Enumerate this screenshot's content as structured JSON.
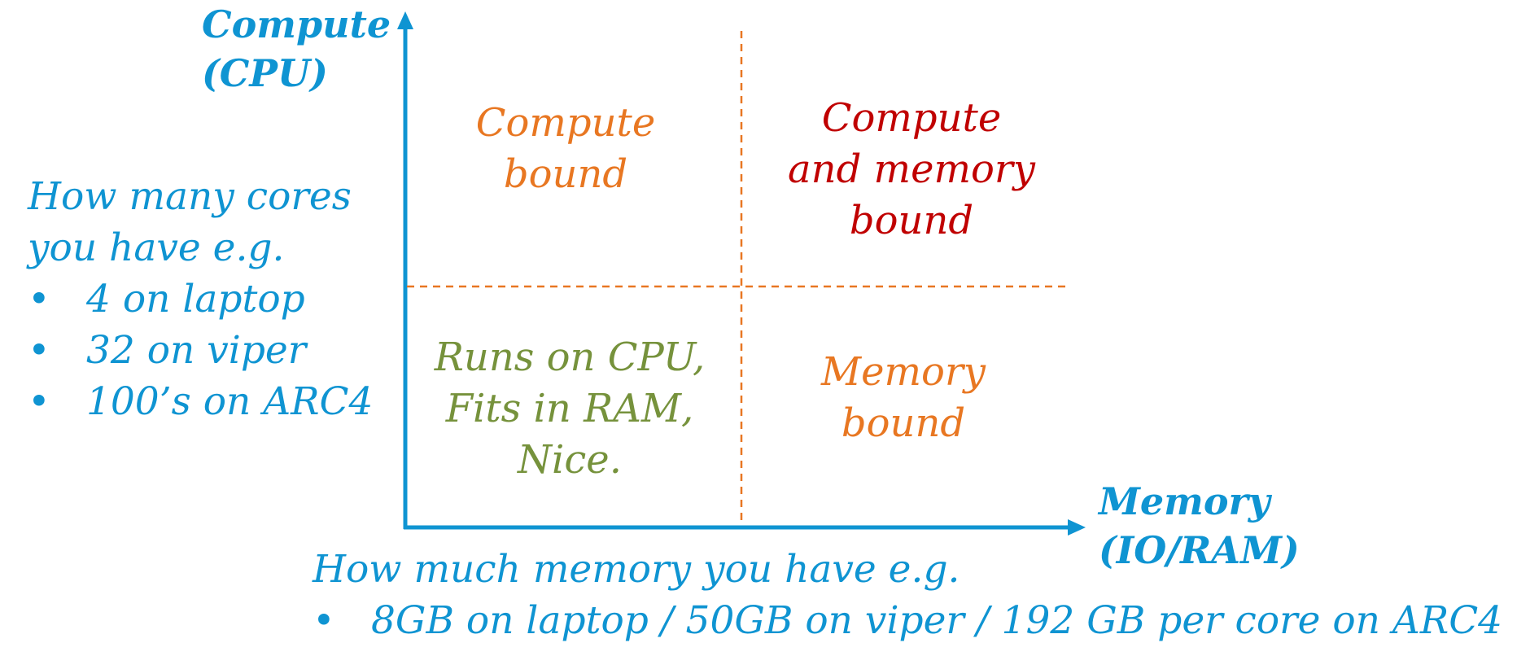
{
  "colors": {
    "axis": "#0f94d2",
    "divider": "#e87722",
    "compute_bound": "#e87722",
    "both_bound": "#c00000",
    "nice": "#76923c",
    "memory_bound": "#e87722"
  },
  "y_axis": {
    "title_line1": "Compute",
    "title_line2": "(CPU)"
  },
  "x_axis": {
    "title_line1": "Memory",
    "title_line2": "(IO/RAM)"
  },
  "quadrants": {
    "top_left": {
      "lines": [
        "Compute",
        "bound"
      ]
    },
    "top_right": {
      "lines": [
        "Compute",
        "and memory",
        "bound"
      ]
    },
    "bottom_left": {
      "lines": [
        "Runs on CPU,",
        "Fits in RAM,",
        "Nice."
      ]
    },
    "bottom_right": {
      "lines": [
        "Memory",
        "bound"
      ]
    }
  },
  "cores_note": {
    "intro_line1": "How many cores",
    "intro_line2": "you have e.g.",
    "bullet_glyph": "•",
    "items": [
      "4 on laptop",
      "32 on viper",
      "100’s on ARC4"
    ]
  },
  "memory_note": {
    "intro": "How much memory you have e.g.",
    "bullet_glyph": "•",
    "item": "8GB on laptop / 50GB on viper / 192 GB per core on ARC4"
  }
}
